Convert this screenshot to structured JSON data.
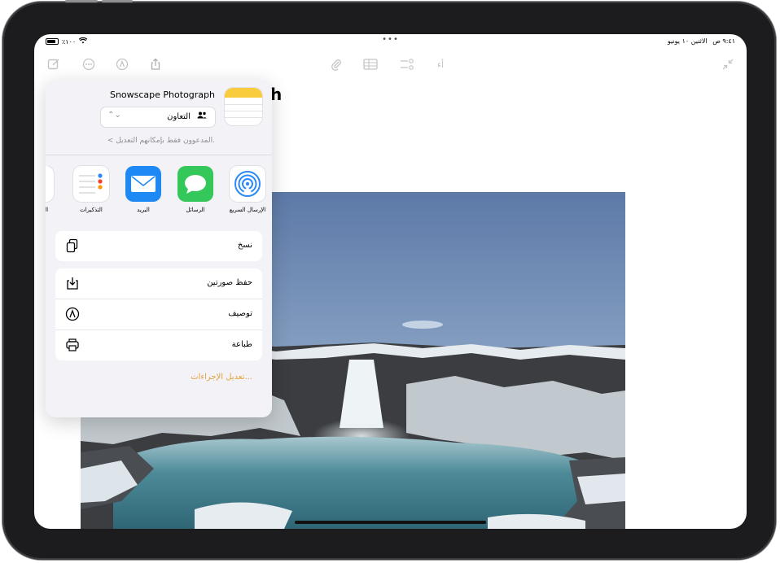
{
  "status_bar": {
    "time": "٩:٤١ ص",
    "date": "الاثنين ١٠ يونيو",
    "battery": "٪١٠٠",
    "dots": "•••"
  },
  "note": {
    "title": "h"
  },
  "share_sheet": {
    "note_name": "Snowscape Photograph",
    "collab_label": "التعاون",
    "permission_text": "المدعوون فقط بإمكانهم التعديل.",
    "apps": [
      {
        "name": "الإرسال السريع",
        "icon": "airdrop-icon"
      },
      {
        "name": "الرسائل",
        "icon": "messages-icon"
      },
      {
        "name": "البريد",
        "icon": "mail-icon"
      },
      {
        "name": "التذكيرات",
        "icon": "reminders-icon"
      },
      {
        "name": "ال",
        "icon": "partial-app-icon"
      }
    ],
    "actions": {
      "copy": "نسخ",
      "save_photos": "حفظ صورتين",
      "markup": "توصيف",
      "print": "طباعة"
    },
    "edit_actions": "تعديل الإجراءات..."
  },
  "colors": {
    "accent": "#e4a23b",
    "airdrop": "#2b8af7",
    "messages": "#34c759",
    "mail": "#1e88f5",
    "notes_yellow": "#f8cc3c"
  }
}
